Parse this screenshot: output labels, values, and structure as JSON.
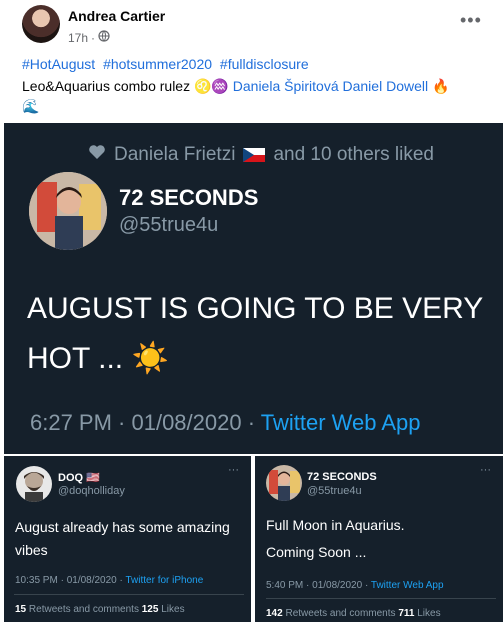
{
  "post": {
    "author": "Andrea Cartier",
    "time": "17h",
    "separator": "·",
    "privacy_icon": "globe-icon",
    "more_icon": "more-options-icon",
    "hashtags": [
      "#HotAugust",
      "#hotsummer2020",
      "#fulldisclosure"
    ],
    "caption_text": "Leo&Aquarius combo rulez",
    "caption_emoji": "♌♒",
    "mentions": [
      "Daniela Špiritová",
      "Daniel Dowell"
    ],
    "caption_end_emoji": "🔥",
    "caption_wave_emoji": "🌊"
  },
  "main_tweet": {
    "liked_icon": "heart-icon",
    "liked_text": "Daniela Frietzi",
    "liked_flag": "czech-flag-icon",
    "liked_suffix": "and 10 others liked",
    "name": "72 SECONDS",
    "handle": "@55true4u",
    "text": "AUGUST IS GOING TO BE VERY HOT ...",
    "text_emoji": "☀️",
    "timestamp": "6:27 PM · 01/08/2020 ·",
    "source": "Twitter Web App",
    "colors": {
      "background": "#15202b",
      "muted": "#8899a6",
      "link": "#1da1f2"
    }
  },
  "tweet_left": {
    "name": "DOQ",
    "flag": "🇺🇸",
    "handle": "@doqholliday",
    "text": "August already has some amazing vibes",
    "timestamp": "10:35 PM · 01/08/2020 ·",
    "source": "Twitter for iPhone",
    "retweets_count": "15",
    "retweets_label": "Retweets and comments",
    "likes_count": "125",
    "likes_label": "Likes",
    "more_icon": "more-options-icon"
  },
  "tweet_right": {
    "name": "72 SECONDS",
    "handle": "@55true4u",
    "text_line1": "Full Moon in Aquarius.",
    "text_line2": "Coming Soon ...",
    "timestamp": "5:40 PM · 01/08/2020 ·",
    "source": "Twitter Web App",
    "retweets_count": "142",
    "retweets_label": "Retweets and comments",
    "likes_count": "711",
    "likes_label": "Likes",
    "more_icon": "more-options-icon"
  }
}
